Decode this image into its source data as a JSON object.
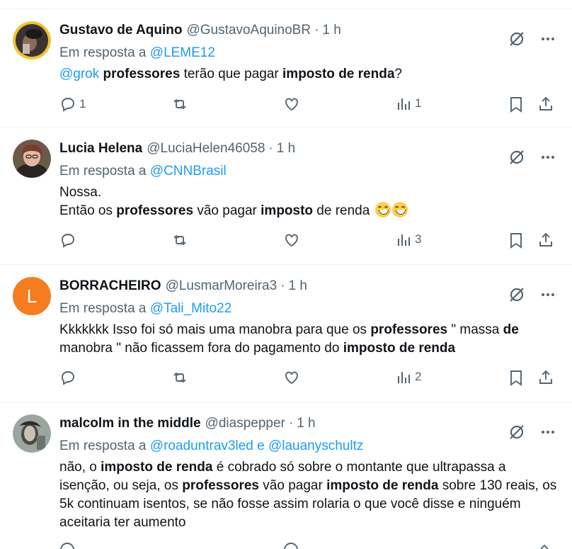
{
  "tweets": [
    {
      "name": "Gustavo de Aquino",
      "handle": "@GustavoAquinoBR",
      "time": "1 h",
      "reply_prefix": "Em resposta a",
      "reply_to": "@LEME12",
      "reply_to_2": "",
      "reply_join": "",
      "replies": "1",
      "retweets": "",
      "likes": "",
      "views": "1"
    },
    {
      "name": "Lucia Helena",
      "handle": "@LuciaHelen46058",
      "time": "1 h",
      "reply_prefix": "Em resposta a",
      "reply_to": "@CNNBrasil",
      "reply_to_2": "",
      "reply_join": "",
      "replies": "",
      "retweets": "",
      "likes": "",
      "views": "3"
    },
    {
      "name": "BORRACHEIRO",
      "handle": "@LusmarMoreira3",
      "time": "1 h",
      "avatar_letter": "L",
      "reply_prefix": "Em resposta a",
      "reply_to": "@Tali_Mito22",
      "reply_to_2": "",
      "reply_join": "",
      "replies": "",
      "retweets": "",
      "likes": "",
      "views": "2"
    },
    {
      "name": "malcolm in the middle",
      "handle": "@diaspepper",
      "time": "1 h",
      "reply_prefix": "Em resposta a",
      "reply_to": "@roaduntrav3led",
      "reply_join": "e",
      "reply_to_2": "@lauanyschultz"
    }
  ],
  "text": {
    "t1_mention": "@grok",
    "t1_a": "professores",
    "t1_b": " terão que pagar ",
    "t1_c": "imposto de renda",
    "t1_d": "?",
    "t2_line1": "Nossa.",
    "t2_a": "Então os ",
    "t2_b": "professores",
    "t2_c": " vão pagar ",
    "t2_d": "imposto",
    "t2_e": " de renda ",
    "t3_a": "Kkkkkkk Isso foi só mais uma manobra para que os ",
    "t3_b": "professores",
    "t3_c": " \" massa ",
    "t3_d": "de",
    "t3_e": " manobra \" não ficassem fora do pagamento do ",
    "t3_f": "imposto de renda",
    "t4_a": "não, o ",
    "t4_b": "imposto de renda",
    "t4_c": " é cobrado só sobre o montante que ultrapassa a isenção, ou seja, os ",
    "t4_d": "professores",
    "t4_e": " vão pagar ",
    "t4_f": "imposto de renda",
    "t4_g": " sobre 130 reais, os 5k continuam isentos, se não fosse assim rolaria o que você disse e ninguém aceitaria ter aumento"
  },
  "colors": {
    "link": "#1d9bf0",
    "muted": "#536471",
    "text": "#0f1419",
    "avatar_orange": "#f57c1f"
  },
  "icons": [
    "reply-icon",
    "retweet-icon",
    "like-icon",
    "views-icon",
    "bookmark-icon",
    "share-icon",
    "grok-icon",
    "more-icon"
  ]
}
